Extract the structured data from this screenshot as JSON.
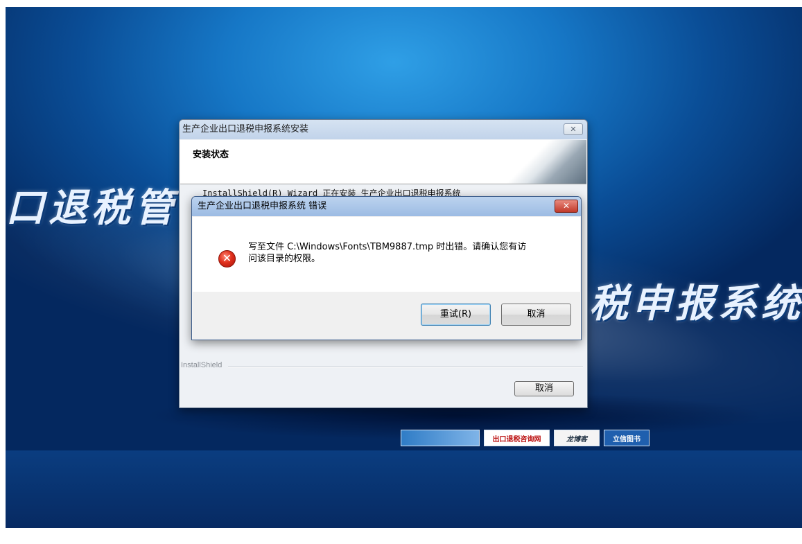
{
  "background": {
    "title_left": "口退税管",
    "title_right": "税申报系统",
    "logos": [
      "",
      "出口退税咨询网",
      "龙博客",
      "立信图书"
    ]
  },
  "installer": {
    "window_title": "生产企业出口退税申报系统安装",
    "close_label": "✕",
    "header_title": "安装状态",
    "progress_text": "InstallShield(R) Wizard 正在安装 生产企业出口退税申报系统",
    "brand_label": "InstallShield",
    "cancel_label": "取消"
  },
  "error_dialog": {
    "title": "生产企业出口退税申报系统 错误",
    "close_label": "✕",
    "icon": "error-icon",
    "message_line1": "写至文件 C:\\Windows\\Fonts\\TBM9887.tmp 时出错。请确认您有访",
    "message_line2": "问该目录的权限。",
    "retry_label": "重试(R)",
    "cancel_label": "取消"
  },
  "colors": {
    "bg_blue": "#0a4d96",
    "error_red": "#e0301c",
    "title_bar": "#c1d3ea"
  }
}
